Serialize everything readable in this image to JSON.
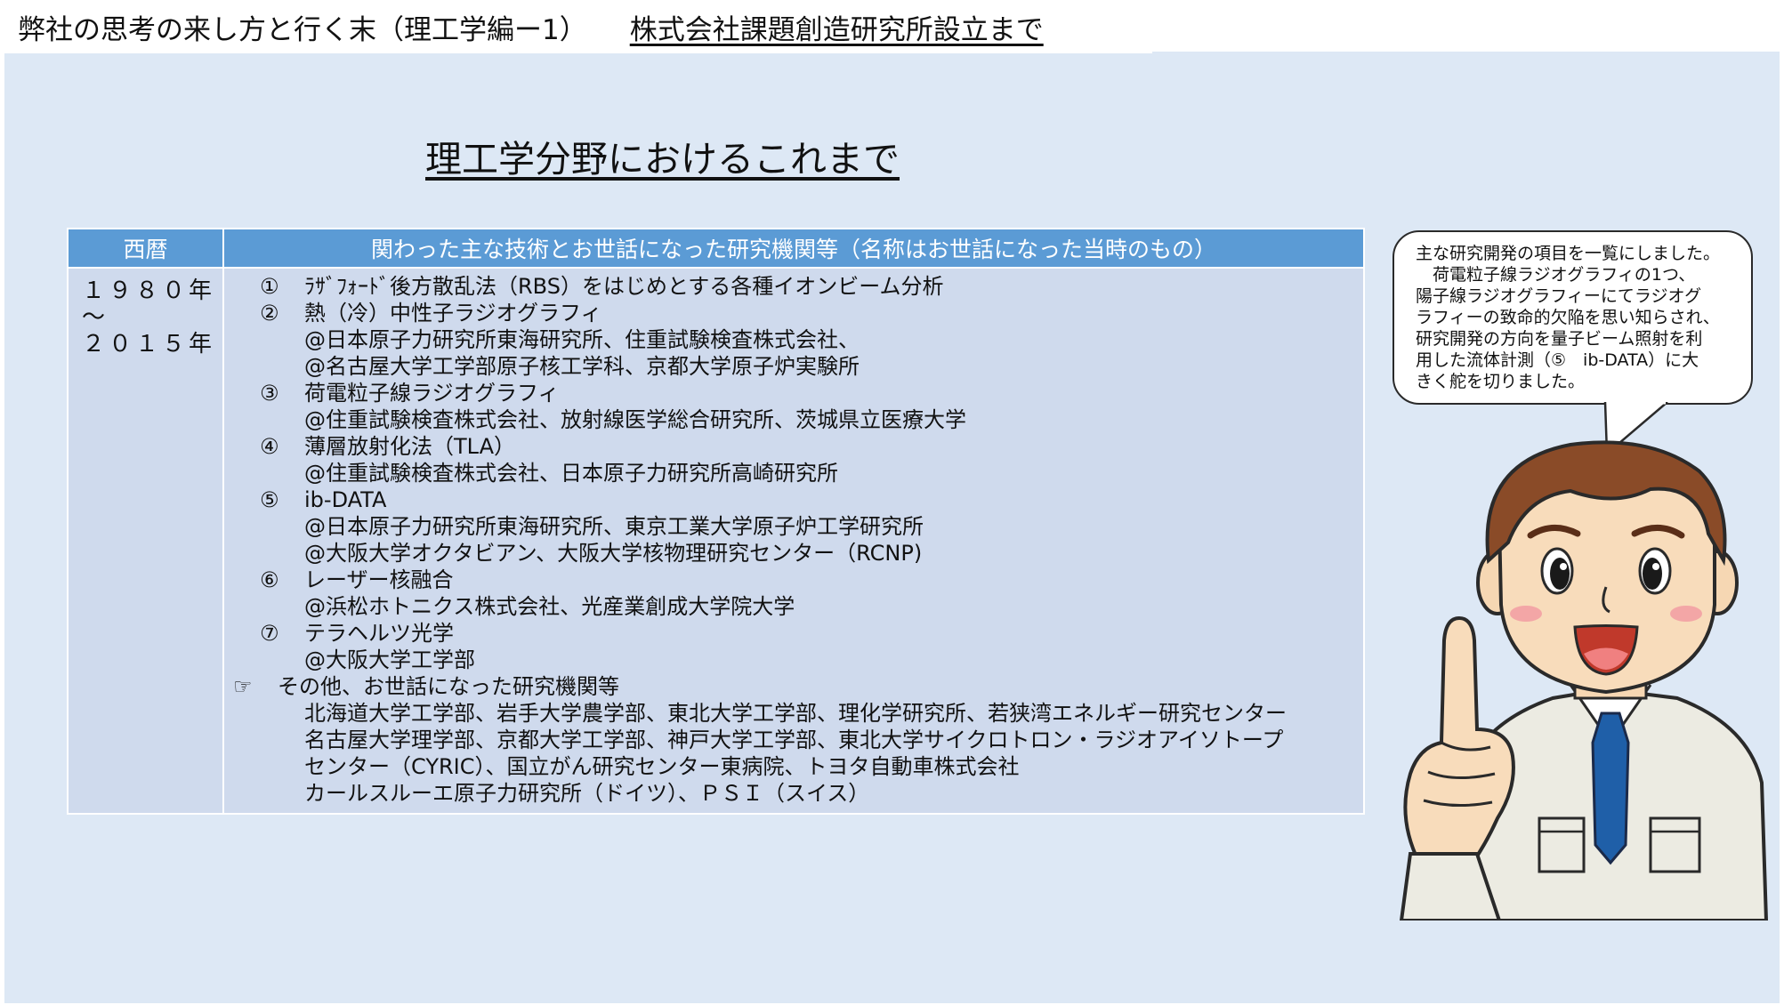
{
  "header": {
    "title_left": "弊社の思考の来し方と行く末（理工学編ー1）",
    "title_right": "株式会社課題創造研究所設立まで"
  },
  "main": {
    "heading": "理工学分野におけるこれまで"
  },
  "table": {
    "col_year": "西暦",
    "col_tech": "関わった主な技術とお世話になった研究機関等（名称はお世話になった当時のもの）",
    "year_start": "１９８０年",
    "year_sep": "～",
    "year_end": "２０１５年",
    "items": [
      {
        "num": "①",
        "title": "ﾗｻﾞﾌｫｰﾄﾞ後方散乱法（RBS）をはじめとする各種イオンビーム分析",
        "orgs": []
      },
      {
        "num": "②",
        "title": "熱（冷）中性子ラジオグラフィ",
        "orgs": [
          "@日本原子力研究所東海研究所、住重試験検査株式会社、",
          "@名古屋大学工学部原子核工学科、京都大学原子炉実験所"
        ]
      },
      {
        "num": "③",
        "title": "荷電粒子線ラジオグラフィ",
        "orgs": [
          "@住重試験検査株式会社、放射線医学総合研究所、茨城県立医療大学"
        ]
      },
      {
        "num": "④",
        "title": "薄層放射化法（TLA）",
        "orgs": [
          "@住重試験検査株式会社、日本原子力研究所高崎研究所"
        ]
      },
      {
        "num": "⑤",
        "title": "ib-DATA",
        "orgs": [
          "@日本原子力研究所東海研究所、東京工業大学原子炉工学研究所",
          "@大阪大学オクタビアン、大阪大学核物理研究センター（RCNP)"
        ]
      },
      {
        "num": "⑥",
        "title": "レーザー核融合",
        "orgs": [
          "@浜松ホトニクス株式会社、光産業創成大学院大学"
        ]
      },
      {
        "num": "⑦",
        "title": "テラヘルツ光学",
        "orgs": [
          "@大阪大学工学部"
        ]
      }
    ],
    "other": {
      "mark": "☞",
      "title": "その他、お世話になった研究機関等",
      "lines": [
        "北海道大学工学部、岩手大学農学部、東北大学工学部、理化学研究所、若狭湾エネルギー研究センター",
        "名古屋大学理学部、京都大学工学部、神戸大学工学部、東北大学サイクロトロン・ラジオアイソトープ",
        "センター（CYRIC）、国立がん研究センター東病院、トヨタ自動車株式会社",
        "カールスルーエ原子力研究所（ドイツ）、ＰＳＩ（スイス）"
      ]
    }
  },
  "speech": {
    "lines": [
      "主な研究開発の項目を一覧にしました。",
      "　荷電粒子線ラジオグラフィの1つ、",
      "陽子線ラジオグラフィーにてラジオグ",
      "ラフィーの致命的欠陥を思い知らされ、",
      "研究開発の方向を量子ビーム照射を利",
      "用した流体計測（⑤　ib-DATA）に大",
      "きく舵を切りました。"
    ]
  },
  "colors": {
    "slide_bg": "#dde8f5",
    "header_fill": "#5b9bd5",
    "cell_fill": "#cfdaed"
  }
}
